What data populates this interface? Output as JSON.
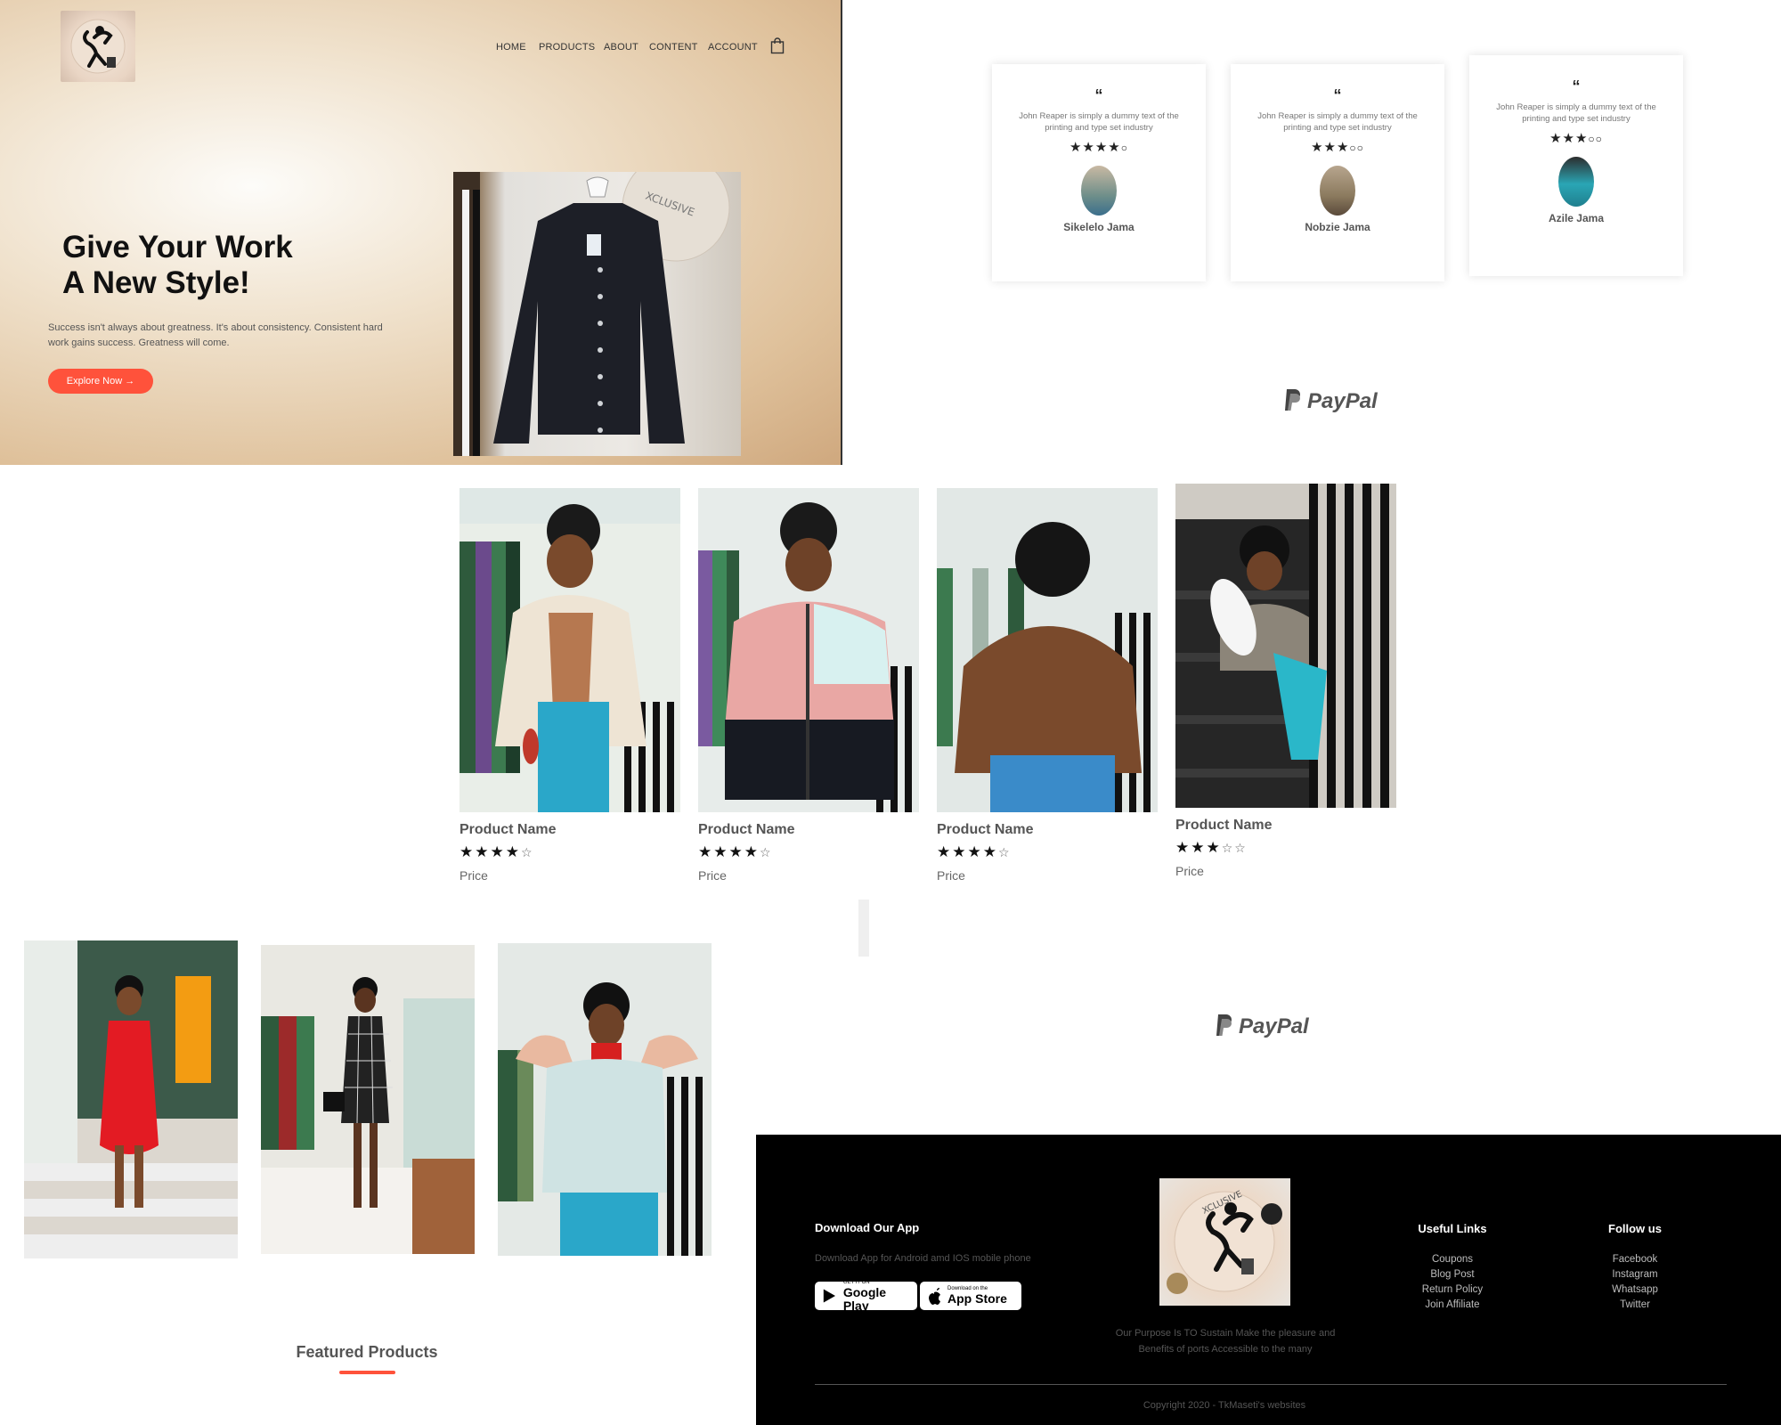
{
  "header": {
    "nav_items": [
      "HOME",
      "PRODUCTS",
      "ABOUT",
      "CONTENT",
      "ACCOUNT"
    ],
    "cart_icon": "shopping-bag-icon",
    "logo_icon": "exclusive-logo"
  },
  "hero": {
    "title_line1": "Give Your Work",
    "title_line2": "A New Style!",
    "subtitle": "Success isn't always about greatness. It's about consistency. Consistent hard work gains success. Greatness will come.",
    "button_label": "Explore Now →",
    "accent_color": "#ff523b"
  },
  "testimonials": [
    {
      "quote_mark": "“",
      "text": "John Reaper is simply a dummy text of the printing and type set industry",
      "rating": 4,
      "name": "Sikelelo Jama"
    },
    {
      "quote_mark": "“",
      "text": "John Reaper is simply a dummy text of the printing and type set industry",
      "rating": 3,
      "name": "Nobzie Jama"
    },
    {
      "quote_mark": "“",
      "text": "John Reaper is simply a dummy text of the printing and type set industry",
      "rating": 3,
      "name": "Azile Jama"
    }
  ],
  "brand_logos": [
    "PayPal",
    "PayPal"
  ],
  "products": [
    {
      "name": "Product Name",
      "rating": 4,
      "price": "Price"
    },
    {
      "name": "Product Name",
      "rating": 4,
      "price": "Price"
    },
    {
      "name": "Product Name",
      "rating": 4,
      "price": "Price"
    },
    {
      "name": "Product Name",
      "rating": 3,
      "price": "Price"
    }
  ],
  "featured": {
    "title": "Featured Products"
  },
  "footer": {
    "app_heading": "Download Our App",
    "app_text": "Download App for Android amd IOS mobile phone",
    "google_play_small": "GET IT ON",
    "google_play_big": "Google Play",
    "app_store_small": "Download on the",
    "app_store_big": "App Store",
    "purpose_text_line1": "Our Purpose Is TO Sustain Make the pleasure and",
    "purpose_text_line2": "Benefits of ports Accessible to the many",
    "useful_links_heading": "Useful Links",
    "useful_links": [
      "Coupons",
      "Blog Post",
      "Return Policy",
      "Join Affiliate"
    ],
    "follow_heading": "Follow us",
    "follow_links": [
      "Facebook",
      "Instagram",
      "Whatsapp",
      "Twitter"
    ],
    "copyright": "Copyright 2020 - TkMaseti's websites"
  }
}
